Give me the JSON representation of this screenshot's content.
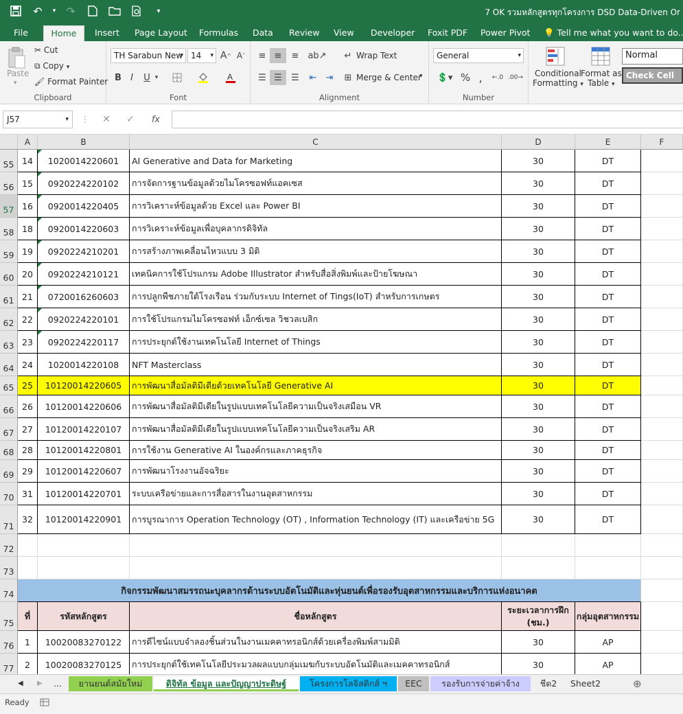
{
  "title": "7 OK รวมหลักสูตรทุกโครงการ DSD Data-Driven Or",
  "menu_tabs": [
    "File",
    "Home",
    "Insert",
    "Page Layout",
    "Formulas",
    "Data",
    "Review",
    "View",
    "Developer",
    "Foxit PDF",
    "Power Pivot",
    "Tell me what you want to do..."
  ],
  "ribbon": {
    "clipboard": {
      "paste": "Paste",
      "cut": "Cut",
      "copy": "Copy",
      "format_painter": "Format Painter",
      "label": "Clipboard"
    },
    "font": {
      "name": "TH Sarabun New",
      "size": "14",
      "label": "Font"
    },
    "alignment": {
      "wrap_text": "Wrap Text",
      "merge_center": "Merge & Center",
      "label": "Alignment"
    },
    "number": {
      "format": "General",
      "label": "Number"
    },
    "styles": {
      "conditional": "Conditional",
      "formatting": "Formatting",
      "format_as": "Format as",
      "table": "Table",
      "normal": "Normal",
      "check_cell": "Check Cell"
    }
  },
  "formula_bar": {
    "name_box": "J57",
    "fx": "fx",
    "value": ""
  },
  "columns": [
    "A",
    "B",
    "C",
    "D",
    "E",
    "F"
  ],
  "rows": [
    {
      "num": "55",
      "a": "14",
      "b": "1020014220601",
      "c": "AI Generative and Data for Marketing",
      "d": "30",
      "e": "DT"
    },
    {
      "num": "56",
      "a": "15",
      "b": "0920224220102",
      "c": "การจัดการฐานข้อมูลด้วยไมโครซอฟท์แอคเซส",
      "d": "30",
      "e": "DT"
    },
    {
      "num": "57",
      "a": "16",
      "b": "0920014220405",
      "c": "การวิเคราะห์ข้อมูลด้วย Excel และ Power BI",
      "d": "30",
      "e": "DT"
    },
    {
      "num": "58",
      "a": "18",
      "b": "0920014220603",
      "c": "การวิเคราะห์ข้อมูลเพื่อบุคลากรดิจิทัล",
      "d": "30",
      "e": "DT"
    },
    {
      "num": "59",
      "a": "19",
      "b": "0920224210201",
      "c": "การสร้างภาพเคลื่อนไหวแบบ 3 มิติ",
      "d": "30",
      "e": "DT"
    },
    {
      "num": "60",
      "a": "20",
      "b": "0920224210121",
      "c": "เทคนิคการใช้โปรแกรม Adobe Illustrator สำหรับสื่อสิ่งพิมพ์และป้ายโฆษณา",
      "d": "30",
      "e": "DT"
    },
    {
      "num": "61",
      "a": "21",
      "b": "0720016260603",
      "c": "การปลูกพืชภายใต้โรงเรือน ร่วมกับระบบ Internet of Tings(IoT) สำหรับการเกษตร",
      "d": "30",
      "e": "DT"
    },
    {
      "num": "62",
      "a": "22",
      "b": "0920224220101",
      "c": "การใช้โปรแกรมไมโครซอฟท์ เอ็กซ์เซล วิชวลเบสิก",
      "d": "30",
      "e": "DT"
    },
    {
      "num": "63",
      "a": "23",
      "b": "0920224220117",
      "c": "การประยุกต์ใช้งานเทคโนโลยี Internet of Things",
      "d": "30",
      "e": "DT"
    },
    {
      "num": "64",
      "a": "24",
      "b": "1020014220108",
      "c": "NFT Masterclass",
      "d": "30",
      "e": "DT"
    },
    {
      "num": "65",
      "a": "25",
      "b": "10120014220605",
      "c": "การพัฒนาสื่อมัลติมีเดียด้วยเทคโนโลยี Generative AI",
      "d": "30",
      "e": "DT"
    },
    {
      "num": "66",
      "a": "26",
      "b": "10120014220606",
      "c": "การพัฒนาสื่อมัลติมีเดียในรูปแบบเทคโนโลยีความเป็นจริงเสมือน VR",
      "d": "30",
      "e": "DT"
    },
    {
      "num": "67",
      "a": "27",
      "b": "10120014220107",
      "c": "การพัฒนาสื่อมัลติมีเดียในรูปแบบเทคโนโลยีความเป็นจริงเสริม AR",
      "d": "30",
      "e": "DT"
    },
    {
      "num": "68",
      "a": "28",
      "b": "10120014220801",
      "c": "การใช้งาน Generative AI ในองค์กรและภาคธุรกิจ",
      "d": "30",
      "e": "DT"
    },
    {
      "num": "69",
      "a": "29",
      "b": "10120014220607",
      "c": "การพัฒนาโรงงานอัจฉริยะ",
      "d": "30",
      "e": "DT"
    },
    {
      "num": "70",
      "a": "31",
      "b": "10120014220701",
      "c": "ระบบเครือข่ายและการสื่อสารในงานอุตสาหกรรม",
      "d": "30",
      "e": "DT"
    },
    {
      "num": "71",
      "a": "32",
      "b": "10120014220901",
      "c": "การบูรณาการ Operation Technology (OT) , Information Technology (IT) และเครือข่าย 5G",
      "d": "30",
      "e": "DT"
    }
  ],
  "empty_rows": [
    "72",
    "73"
  ],
  "section_row": {
    "num": "74",
    "title": "กิจกรรมพัฒนาสมรรถนะบุคลากรด้านระบบอัตโนมัติและหุ่นยนต์เพื่อรองรับอุตสาหกรรมและบริการแห่งอนาคต"
  },
  "header_row": {
    "num": "75",
    "a": "ที่",
    "b": "รหัสหลักสูตร",
    "c": "ชื่อหลักสูตร",
    "d1": "ระยะเวลาการฝึก",
    "d2": "(ชม.)",
    "e": "กลุ่มอุตสาหกรรม"
  },
  "bottom_rows": [
    {
      "num": "76",
      "a": "1",
      "b": "10020083270122",
      "c": "การดีไซน์แบบจำลองชิ้นส่วนในงานเมคคาทรอนิกส์ด้วยเครื่องพิมพ์สามมิติ",
      "d": "30",
      "e": "AP"
    },
    {
      "num": "77",
      "a": "2",
      "b": "10020083270125",
      "c": "การประยุกต์ใช้เทคโนโลยีประมวลผลแบบกลุ่มเมฆกับระบบอัตโนมัติและเมคคาทรอนิกส์",
      "d": "30",
      "e": "AP"
    }
  ],
  "sheet_tabs": {
    "ellipsis": "...",
    "tabs": [
      {
        "label": "ยานยนต์สมัยใหม่",
        "color": "#92d050"
      },
      {
        "label": "ดิจิทัล ข้อมูล และปัญญาประดิษฐ์",
        "color": "#92d050"
      },
      {
        "label": "โครงการโลจิสติกส์ ฯ",
        "color": "#00b0f0"
      },
      {
        "label": "EEC",
        "color": "#c0c0c0"
      },
      {
        "label": "รองรับการจ่ายค่าจ้าง",
        "color": "#ccccff"
      },
      {
        "label": "ชีต2",
        "color": ""
      },
      {
        "label": "Sheet2",
        "color": ""
      }
    ]
  },
  "status": {
    "ready": "Ready"
  },
  "colors": {
    "excel_green": "#217346",
    "highlight_yellow": "#ffff00",
    "section_blue": "#9bc2e6",
    "header_pink": "#f2dcdb"
  }
}
